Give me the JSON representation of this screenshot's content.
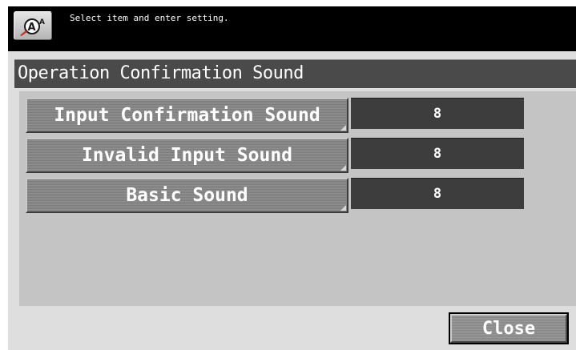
{
  "header": {
    "help_icon": "accessibility-aa-icon",
    "instruction": "Select item and enter setting."
  },
  "page": {
    "title": "Operation Confirmation Sound"
  },
  "settings": [
    {
      "label": "Input Confirmation Sound",
      "value": "8"
    },
    {
      "label": "Invalid Input Sound",
      "value": "8"
    },
    {
      "label": "Basic Sound",
      "value": "8"
    }
  ],
  "footer": {
    "close_label": "Close"
  },
  "colors": {
    "top_bar": "#000000",
    "title_bar": "#4a4a4a",
    "panel": "#c4c4c4",
    "value_box": "#3d3d3d"
  }
}
